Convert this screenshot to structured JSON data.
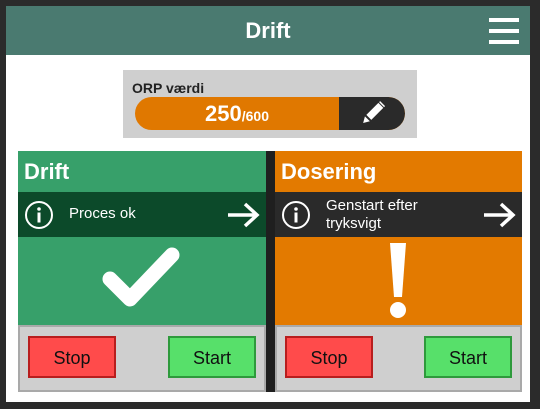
{
  "header": {
    "title": "Drift",
    "menu_icon": "hamburger-menu-icon"
  },
  "orp": {
    "label": "ORP værdi",
    "value": "250",
    "max": "/600",
    "edit_icon": "pencil-icon",
    "bar_color": "#e07800"
  },
  "panels": {
    "left": {
      "title": "Drift",
      "status_text": "Proces ok",
      "status_icon": "checkmark-icon",
      "color": "#37a06a",
      "stop_label": "Stop",
      "start_label": "Start"
    },
    "right": {
      "title": "Dosering",
      "status_text": "Genstart efter tryksvigt",
      "status_icon": "exclamation-icon",
      "color": "#e37a00",
      "stop_label": "Stop",
      "start_label": "Start"
    }
  }
}
